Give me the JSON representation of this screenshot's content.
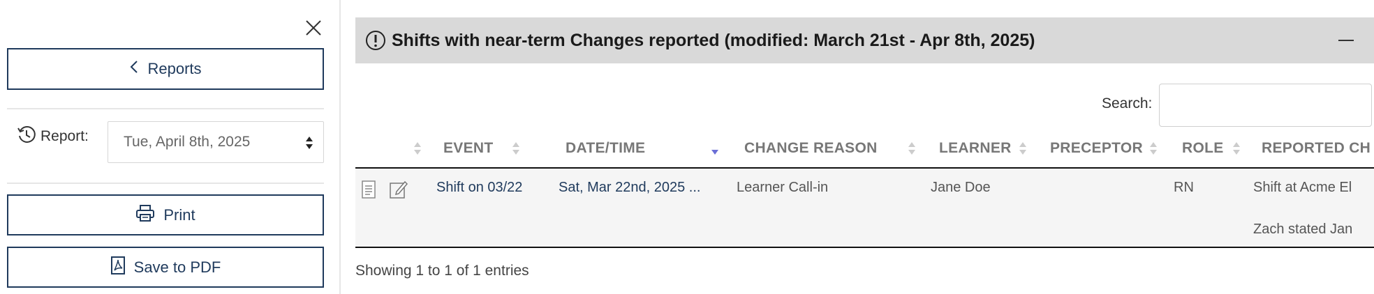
{
  "sidebar": {
    "reports_label": "Reports",
    "report_label": "Report:",
    "report_date": "Tue, April 8th, 2025",
    "print_label": "Print",
    "save_pdf_label": "Save to PDF"
  },
  "panel": {
    "title": "Shifts with near-term Changes reported (modified: March 21st - Apr 8th, 2025)"
  },
  "search": {
    "label": "Search:",
    "value": ""
  },
  "table": {
    "columns": [
      "EVENT",
      "DATE/TIME",
      "CHANGE REASON",
      "LEARNER",
      "PRECEPTOR",
      "ROLE",
      "REPORTED CH"
    ],
    "sorted_column": "DATE/TIME",
    "sort_direction": "descending",
    "rows": [
      {
        "event": "Shift on 03/22",
        "datetime": "Sat, Mar 22nd, 2025 ...",
        "change_reason": "Learner Call-in",
        "learner": "Jane Doe",
        "preceptor": "",
        "role": "RN",
        "reported_line1": "Shift at Acme El",
        "reported_line2": "Zach stated Jan"
      }
    ]
  },
  "footer": {
    "info": "Showing 1 to 1 of 1 entries"
  },
  "colors": {
    "navy": "#1f3a5c",
    "header_bg": "#d9d9d9",
    "row_bg": "#f5f5f5",
    "sort_active": "#6b6fd6"
  }
}
